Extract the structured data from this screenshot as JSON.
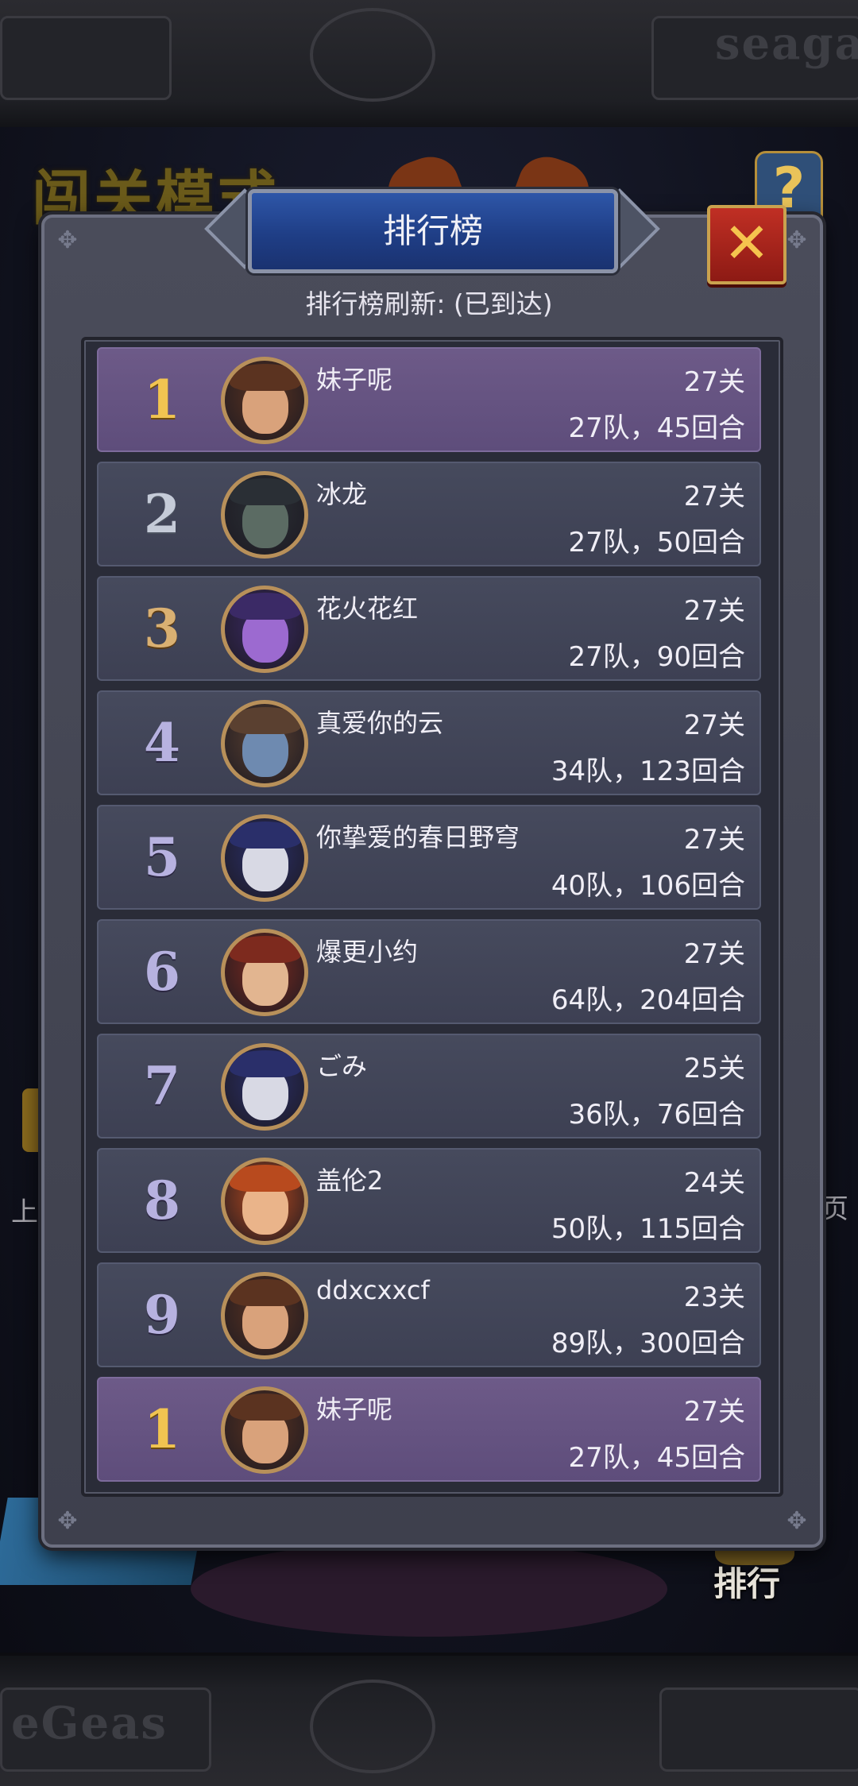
{
  "backdrop": {
    "mode_title": "闯关模式",
    "top_brand": "seaga",
    "bottom_brand": "eGeas",
    "left_side_label": "上",
    "right_side_label": "页",
    "rank_button_label": "排行"
  },
  "dialog": {
    "title": "排行榜",
    "close_icon": "x-icon",
    "refresh_status": "排行榜刷新: (已到达)"
  },
  "leaderboard": [
    {
      "rank": "1",
      "name": "妹子呢",
      "stage": "27关",
      "stats": "27队，45回合",
      "highlight": true,
      "medal": "gold",
      "avatar": "pirate-girl-avatar"
    },
    {
      "rank": "2",
      "name": "冰龙",
      "stage": "27关",
      "stats": "27队，50回合",
      "highlight": false,
      "medal": "silver",
      "avatar": "dark-knight-avatar"
    },
    {
      "rank": "3",
      "name": "花火花红",
      "stage": "27关",
      "stats": "27队，90回合",
      "highlight": false,
      "medal": "bronze",
      "avatar": "purple-mage-avatar"
    },
    {
      "rank": "4",
      "name": "真爱你的云",
      "stage": "27关",
      "stats": "34队，123回合",
      "highlight": false,
      "medal": "plain",
      "avatar": "goblin-pilot-avatar"
    },
    {
      "rank": "5",
      "name": "你挚爱的春日野穹",
      "stage": "27关",
      "stats": "40队，106回合",
      "highlight": false,
      "medal": "plain",
      "avatar": "samurai-robot-avatar"
    },
    {
      "rank": "6",
      "name": "爆更小约",
      "stage": "27关",
      "stats": "64队，204回合",
      "highlight": false,
      "medal": "plain",
      "avatar": "dwarf-miner-avatar"
    },
    {
      "rank": "7",
      "name": "ごみ",
      "stage": "25关",
      "stats": "36队，76回合",
      "highlight": false,
      "medal": "plain",
      "avatar": "samurai-robot-avatar"
    },
    {
      "rank": "8",
      "name": "盖伦2",
      "stage": "24关",
      "stats": "50队，115回合",
      "highlight": false,
      "medal": "plain",
      "avatar": "redhead-boy-avatar"
    },
    {
      "rank": "9",
      "name": "ddxcxxcf",
      "stage": "23关",
      "stats": "89队，300回合",
      "highlight": false,
      "medal": "plain",
      "avatar": "pirate-girl-avatar"
    }
  ],
  "my_rank": {
    "rank": "1",
    "name": "妹子呢",
    "stage": "27关",
    "stats": "27队，45回合",
    "highlight": true,
    "medal": "gold",
    "avatar": "pirate-girl-avatar"
  },
  "colors": {
    "highlight_row": "#6d5a88",
    "normal_row": "#464a5d",
    "gold_rank": "#f1c451",
    "title_plate": "#2e56a8",
    "close_button": "#c02f24"
  }
}
